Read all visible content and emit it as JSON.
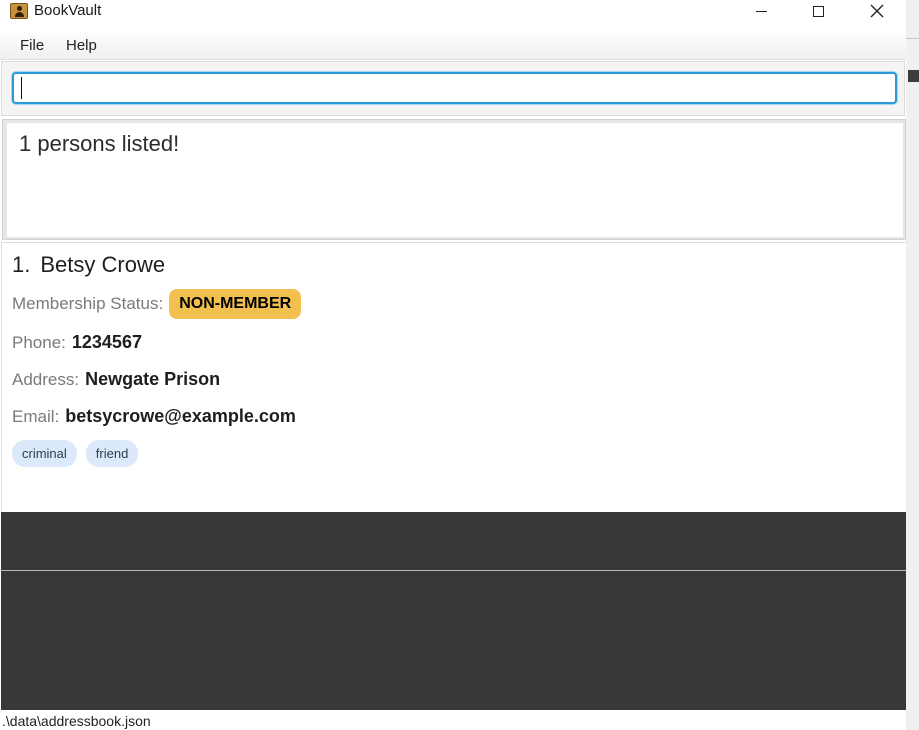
{
  "window": {
    "title": "BookVault",
    "app_icon": "address-book-icon",
    "controls": [
      "minimize-icon",
      "maximize-icon",
      "close-icon"
    ]
  },
  "menu": {
    "items": [
      {
        "label": "File"
      },
      {
        "label": "Help"
      }
    ]
  },
  "command_box": {
    "value": "",
    "placeholder": ""
  },
  "result_display": {
    "text": "1 persons listed!"
  },
  "person_list": {
    "persons": [
      {
        "index": "1.",
        "name": "Betsy Crowe",
        "membership_label": "Membership Status:",
        "membership_status": "NON-MEMBER",
        "phone_label": "Phone:",
        "phone": "1234567",
        "address_label": "Address:",
        "address": "Newgate Prison",
        "email_label": "Email:",
        "email": "betsycrowe@example.com",
        "tags": [
          "criminal",
          "friend"
        ]
      }
    ]
  },
  "status_bar": {
    "file_path": ".\\data\\addressbook.json"
  },
  "colors": {
    "accent": "#2a9bd6",
    "badge": "#f1c04f",
    "tag_bg": "#dbe9fb",
    "dark_panel": "#383838"
  }
}
